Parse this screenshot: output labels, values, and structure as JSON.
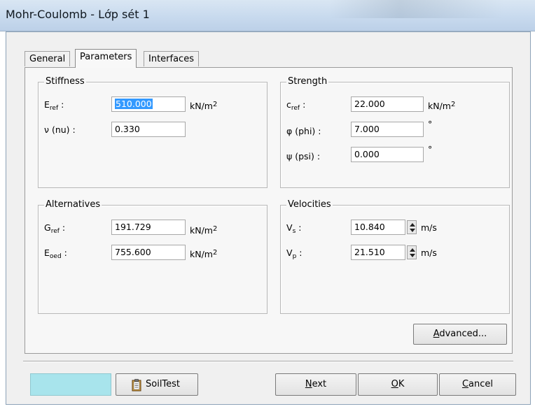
{
  "window": {
    "title": "Mohr-Coulomb - Lớp sét 1"
  },
  "tabs": [
    {
      "label": "General",
      "active": false
    },
    {
      "label": "Parameters",
      "active": true
    },
    {
      "label": "Interfaces",
      "active": false
    }
  ],
  "stiffness": {
    "legend": "Stiffness",
    "eref": {
      "label_main": "E",
      "label_sub": "ref",
      "label_suffix": " :",
      "value": "510.000",
      "unit_main": "kN/m",
      "unit_sup": "2"
    },
    "nu": {
      "label": "ν (nu) :",
      "value": "0.330"
    }
  },
  "strength": {
    "legend": "Strength",
    "cref": {
      "label_main": "c",
      "label_sub": "ref",
      "label_suffix": " :",
      "value": "22.000",
      "unit_main": "kN/m",
      "unit_sup": "2"
    },
    "phi": {
      "label": "φ (phi) :",
      "value": "7.000",
      "unit": "°"
    },
    "psi": {
      "label": "ψ (psi) :",
      "value": "0.000",
      "unit": "°"
    }
  },
  "alternatives": {
    "legend": "Alternatives",
    "gref": {
      "label_main": "G",
      "label_sub": "ref",
      "label_suffix": " :",
      "value": "191.729",
      "unit_main": "kN/m",
      "unit_sup": "2"
    },
    "eoed": {
      "label_main": "E",
      "label_sub": "oed",
      "label_suffix": " :",
      "value": "755.600",
      "unit_main": "kN/m",
      "unit_sup": "2"
    }
  },
  "velocities": {
    "legend": "Velocities",
    "vs": {
      "label_main": "V",
      "label_sub": "s",
      "label_suffix": " :",
      "value": "10.840",
      "unit": "m/s"
    },
    "vp": {
      "label_main": "V",
      "label_sub": "p",
      "label_suffix": " :",
      "value": "21.510",
      "unit": "m/s"
    }
  },
  "buttons": {
    "advanced": {
      "pre": "",
      "key": "A",
      "post": "dvanced..."
    },
    "soiltest": "SoilTest",
    "next": {
      "pre": "",
      "key": "N",
      "post": "ext"
    },
    "ok": {
      "pre": "",
      "key": "O",
      "post": "K"
    },
    "cancel": {
      "pre": "",
      "key": "C",
      "post": "ancel"
    }
  },
  "colors": {
    "titlebar": "#c8daee",
    "selection": "#3399ff",
    "color_swatch": "#a8e4ec",
    "window_bg": "#f0f0f0"
  },
  "icons": {
    "soiltest": "clipboard-icon"
  }
}
